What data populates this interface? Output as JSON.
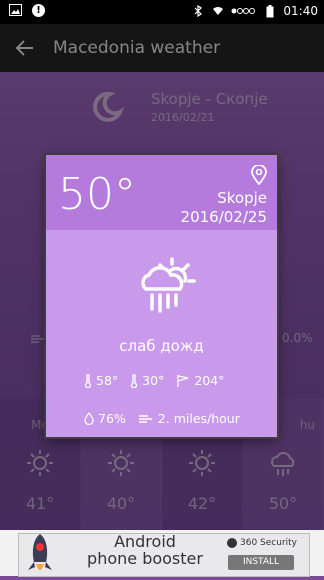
{
  "status_bar": {
    "time": "01:40"
  },
  "app_bar": {
    "title": "Macedonia weather"
  },
  "background": {
    "city": "Skopje - Скопје",
    "date": "2016/02/21",
    "humidity_partial": "0.0%",
    "forecast": [
      {
        "label": "Mo",
        "temp": "41°",
        "icon": "sun-icon"
      },
      {
        "label": "",
        "temp": "40°",
        "icon": "sun-icon"
      },
      {
        "label": "",
        "temp": "42°",
        "icon": "sun-icon"
      },
      {
        "label": "hu",
        "temp": "50°",
        "icon": "cloud-rain-sun-icon"
      }
    ]
  },
  "dialog": {
    "temperature": "50°",
    "city": "Skopje",
    "date": "2016/02/25",
    "condition": "слаб дожд",
    "temp_max": "58°",
    "temp_min": "30°",
    "wind_direction": "204°",
    "humidity": "76%",
    "wind_speed": "2. miles/hour",
    "colors": {
      "header": "#b47bdd",
      "body": "#c99aeb"
    }
  },
  "ad": {
    "line1": "Android",
    "line2": "phone booster",
    "brand": "360 Security",
    "install": "INSTALL"
  }
}
